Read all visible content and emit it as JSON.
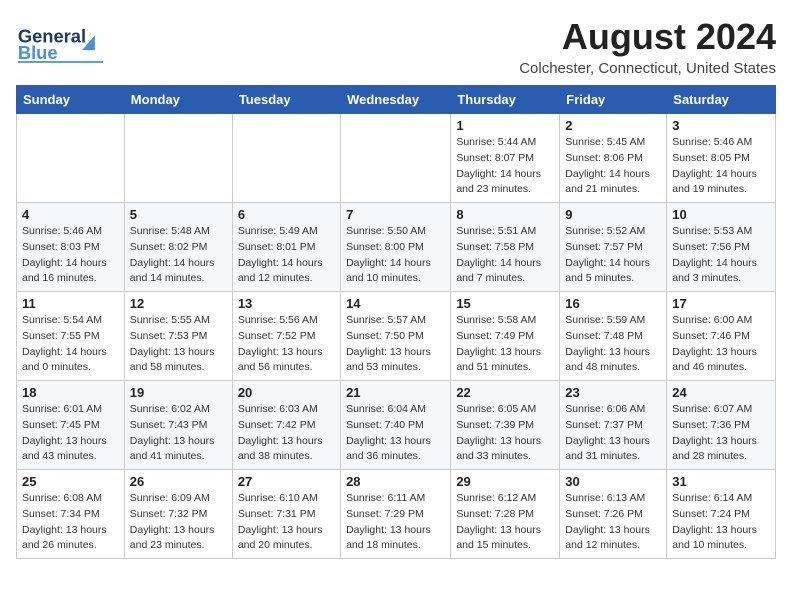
{
  "header": {
    "logo_text_main": "General",
    "logo_text_accent": "Blue",
    "month_title": "August 2024",
    "location": "Colchester, Connecticut, United States"
  },
  "calendar": {
    "days_of_week": [
      "Sunday",
      "Monday",
      "Tuesday",
      "Wednesday",
      "Thursday",
      "Friday",
      "Saturday"
    ],
    "weeks": [
      [
        {
          "day": "",
          "info": ""
        },
        {
          "day": "",
          "info": ""
        },
        {
          "day": "",
          "info": ""
        },
        {
          "day": "",
          "info": ""
        },
        {
          "day": "1",
          "info": "Sunrise: 5:44 AM\nSunset: 8:07 PM\nDaylight: 14 hours\nand 23 minutes."
        },
        {
          "day": "2",
          "info": "Sunrise: 5:45 AM\nSunset: 8:06 PM\nDaylight: 14 hours\nand 21 minutes."
        },
        {
          "day": "3",
          "info": "Sunrise: 5:46 AM\nSunset: 8:05 PM\nDaylight: 14 hours\nand 19 minutes."
        }
      ],
      [
        {
          "day": "4",
          "info": "Sunrise: 5:46 AM\nSunset: 8:03 PM\nDaylight: 14 hours\nand 16 minutes."
        },
        {
          "day": "5",
          "info": "Sunrise: 5:48 AM\nSunset: 8:02 PM\nDaylight: 14 hours\nand 14 minutes."
        },
        {
          "day": "6",
          "info": "Sunrise: 5:49 AM\nSunset: 8:01 PM\nDaylight: 14 hours\nand 12 minutes."
        },
        {
          "day": "7",
          "info": "Sunrise: 5:50 AM\nSunset: 8:00 PM\nDaylight: 14 hours\nand 10 minutes."
        },
        {
          "day": "8",
          "info": "Sunrise: 5:51 AM\nSunset: 7:58 PM\nDaylight: 14 hours\nand 7 minutes."
        },
        {
          "day": "9",
          "info": "Sunrise: 5:52 AM\nSunset: 7:57 PM\nDaylight: 14 hours\nand 5 minutes."
        },
        {
          "day": "10",
          "info": "Sunrise: 5:53 AM\nSunset: 7:56 PM\nDaylight: 14 hours\nand 3 minutes."
        }
      ],
      [
        {
          "day": "11",
          "info": "Sunrise: 5:54 AM\nSunset: 7:55 PM\nDaylight: 14 hours\nand 0 minutes."
        },
        {
          "day": "12",
          "info": "Sunrise: 5:55 AM\nSunset: 7:53 PM\nDaylight: 13 hours\nand 58 minutes."
        },
        {
          "day": "13",
          "info": "Sunrise: 5:56 AM\nSunset: 7:52 PM\nDaylight: 13 hours\nand 56 minutes."
        },
        {
          "day": "14",
          "info": "Sunrise: 5:57 AM\nSunset: 7:50 PM\nDaylight: 13 hours\nand 53 minutes."
        },
        {
          "day": "15",
          "info": "Sunrise: 5:58 AM\nSunset: 7:49 PM\nDaylight: 13 hours\nand 51 minutes."
        },
        {
          "day": "16",
          "info": "Sunrise: 5:59 AM\nSunset: 7:48 PM\nDaylight: 13 hours\nand 48 minutes."
        },
        {
          "day": "17",
          "info": "Sunrise: 6:00 AM\nSunset: 7:46 PM\nDaylight: 13 hours\nand 46 minutes."
        }
      ],
      [
        {
          "day": "18",
          "info": "Sunrise: 6:01 AM\nSunset: 7:45 PM\nDaylight: 13 hours\nand 43 minutes."
        },
        {
          "day": "19",
          "info": "Sunrise: 6:02 AM\nSunset: 7:43 PM\nDaylight: 13 hours\nand 41 minutes."
        },
        {
          "day": "20",
          "info": "Sunrise: 6:03 AM\nSunset: 7:42 PM\nDaylight: 13 hours\nand 38 minutes."
        },
        {
          "day": "21",
          "info": "Sunrise: 6:04 AM\nSunset: 7:40 PM\nDaylight: 13 hours\nand 36 minutes."
        },
        {
          "day": "22",
          "info": "Sunrise: 6:05 AM\nSunset: 7:39 PM\nDaylight: 13 hours\nand 33 minutes."
        },
        {
          "day": "23",
          "info": "Sunrise: 6:06 AM\nSunset: 7:37 PM\nDaylight: 13 hours\nand 31 minutes."
        },
        {
          "day": "24",
          "info": "Sunrise: 6:07 AM\nSunset: 7:36 PM\nDaylight: 13 hours\nand 28 minutes."
        }
      ],
      [
        {
          "day": "25",
          "info": "Sunrise: 6:08 AM\nSunset: 7:34 PM\nDaylight: 13 hours\nand 26 minutes."
        },
        {
          "day": "26",
          "info": "Sunrise: 6:09 AM\nSunset: 7:32 PM\nDaylight: 13 hours\nand 23 minutes."
        },
        {
          "day": "27",
          "info": "Sunrise: 6:10 AM\nSunset: 7:31 PM\nDaylight: 13 hours\nand 20 minutes."
        },
        {
          "day": "28",
          "info": "Sunrise: 6:11 AM\nSunset: 7:29 PM\nDaylight: 13 hours\nand 18 minutes."
        },
        {
          "day": "29",
          "info": "Sunrise: 6:12 AM\nSunset: 7:28 PM\nDaylight: 13 hours\nand 15 minutes."
        },
        {
          "day": "30",
          "info": "Sunrise: 6:13 AM\nSunset: 7:26 PM\nDaylight: 13 hours\nand 12 minutes."
        },
        {
          "day": "31",
          "info": "Sunrise: 6:14 AM\nSunset: 7:24 PM\nDaylight: 13 hours\nand 10 minutes."
        }
      ]
    ]
  }
}
